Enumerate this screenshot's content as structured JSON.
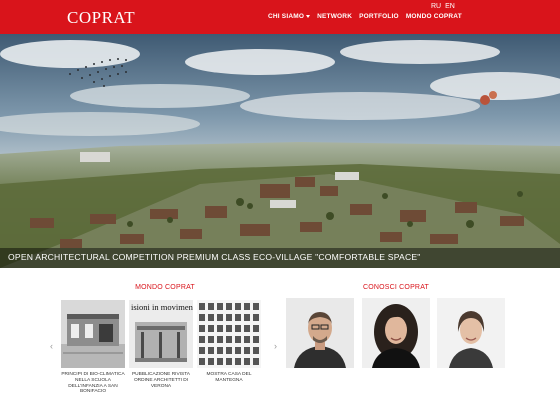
{
  "header": {
    "logo": "COPRAT",
    "nav": [
      {
        "label": "CHI SIAMO",
        "has_dropdown": true
      },
      {
        "label": "NETWORK",
        "has_dropdown": false
      },
      {
        "label": "PORTFOLIO",
        "has_dropdown": false
      },
      {
        "label": "MONDO COPRAT",
        "has_dropdown": false
      }
    ],
    "languages": [
      "RU",
      "EN"
    ]
  },
  "hero": {
    "caption": "OPEN ARCHITECTURAL COMPETITION PREMIUM CLASS ECO-VILLAGE \"COMFORTABLE SPACE\""
  },
  "mondo": {
    "title": "MONDO COPRAT",
    "prev_arrow": "‹",
    "next_arrow": "›",
    "items": [
      {
        "caption": "PRINCIPI DI BIO-CLIMATICA NELLA SCUOLA DELL'INFANZIA A SAN BONIFACIO"
      },
      {
        "caption": "PUBBLICAZIONE RIVISTA ORDINE ARCHITETTI DI VERONA",
        "image_text": "isioni in movimen"
      },
      {
        "caption": "MOSTRA CASA DEL MANTEGNA"
      }
    ]
  },
  "conosci": {
    "title": "CONOSCI COPRAT"
  },
  "colors": {
    "brand_red": "#d9141b",
    "caption_bar": "rgba(0,0,0,0.45)"
  }
}
